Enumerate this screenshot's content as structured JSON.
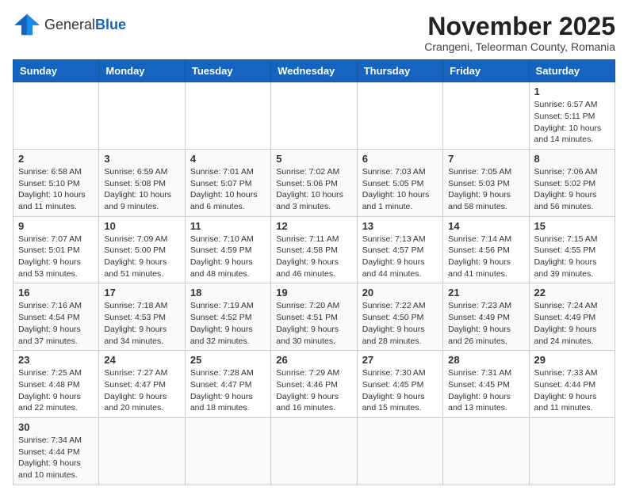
{
  "logo": {
    "text_general": "General",
    "text_blue": "Blue"
  },
  "title": "November 2025",
  "subtitle": "Crangeni, Teleorman County, Romania",
  "days_header": [
    "Sunday",
    "Monday",
    "Tuesday",
    "Wednesday",
    "Thursday",
    "Friday",
    "Saturday"
  ],
  "weeks": [
    [
      {
        "day": "",
        "info": ""
      },
      {
        "day": "",
        "info": ""
      },
      {
        "day": "",
        "info": ""
      },
      {
        "day": "",
        "info": ""
      },
      {
        "day": "",
        "info": ""
      },
      {
        "day": "",
        "info": ""
      },
      {
        "day": "1",
        "info": "Sunrise: 6:57 AM\nSunset: 5:11 PM\nDaylight: 10 hours and 14 minutes."
      }
    ],
    [
      {
        "day": "2",
        "info": "Sunrise: 6:58 AM\nSunset: 5:10 PM\nDaylight: 10 hours and 11 minutes."
      },
      {
        "day": "3",
        "info": "Sunrise: 6:59 AM\nSunset: 5:08 PM\nDaylight: 10 hours and 9 minutes."
      },
      {
        "day": "4",
        "info": "Sunrise: 7:01 AM\nSunset: 5:07 PM\nDaylight: 10 hours and 6 minutes."
      },
      {
        "day": "5",
        "info": "Sunrise: 7:02 AM\nSunset: 5:06 PM\nDaylight: 10 hours and 3 minutes."
      },
      {
        "day": "6",
        "info": "Sunrise: 7:03 AM\nSunset: 5:05 PM\nDaylight: 10 hours and 1 minute."
      },
      {
        "day": "7",
        "info": "Sunrise: 7:05 AM\nSunset: 5:03 PM\nDaylight: 9 hours and 58 minutes."
      },
      {
        "day": "8",
        "info": "Sunrise: 7:06 AM\nSunset: 5:02 PM\nDaylight: 9 hours and 56 minutes."
      }
    ],
    [
      {
        "day": "9",
        "info": "Sunrise: 7:07 AM\nSunset: 5:01 PM\nDaylight: 9 hours and 53 minutes."
      },
      {
        "day": "10",
        "info": "Sunrise: 7:09 AM\nSunset: 5:00 PM\nDaylight: 9 hours and 51 minutes."
      },
      {
        "day": "11",
        "info": "Sunrise: 7:10 AM\nSunset: 4:59 PM\nDaylight: 9 hours and 48 minutes."
      },
      {
        "day": "12",
        "info": "Sunrise: 7:11 AM\nSunset: 4:58 PM\nDaylight: 9 hours and 46 minutes."
      },
      {
        "day": "13",
        "info": "Sunrise: 7:13 AM\nSunset: 4:57 PM\nDaylight: 9 hours and 44 minutes."
      },
      {
        "day": "14",
        "info": "Sunrise: 7:14 AM\nSunset: 4:56 PM\nDaylight: 9 hours and 41 minutes."
      },
      {
        "day": "15",
        "info": "Sunrise: 7:15 AM\nSunset: 4:55 PM\nDaylight: 9 hours and 39 minutes."
      }
    ],
    [
      {
        "day": "16",
        "info": "Sunrise: 7:16 AM\nSunset: 4:54 PM\nDaylight: 9 hours and 37 minutes."
      },
      {
        "day": "17",
        "info": "Sunrise: 7:18 AM\nSunset: 4:53 PM\nDaylight: 9 hours and 34 minutes."
      },
      {
        "day": "18",
        "info": "Sunrise: 7:19 AM\nSunset: 4:52 PM\nDaylight: 9 hours and 32 minutes."
      },
      {
        "day": "19",
        "info": "Sunrise: 7:20 AM\nSunset: 4:51 PM\nDaylight: 9 hours and 30 minutes."
      },
      {
        "day": "20",
        "info": "Sunrise: 7:22 AM\nSunset: 4:50 PM\nDaylight: 9 hours and 28 minutes."
      },
      {
        "day": "21",
        "info": "Sunrise: 7:23 AM\nSunset: 4:49 PM\nDaylight: 9 hours and 26 minutes."
      },
      {
        "day": "22",
        "info": "Sunrise: 7:24 AM\nSunset: 4:49 PM\nDaylight: 9 hours and 24 minutes."
      }
    ],
    [
      {
        "day": "23",
        "info": "Sunrise: 7:25 AM\nSunset: 4:48 PM\nDaylight: 9 hours and 22 minutes."
      },
      {
        "day": "24",
        "info": "Sunrise: 7:27 AM\nSunset: 4:47 PM\nDaylight: 9 hours and 20 minutes."
      },
      {
        "day": "25",
        "info": "Sunrise: 7:28 AM\nSunset: 4:47 PM\nDaylight: 9 hours and 18 minutes."
      },
      {
        "day": "26",
        "info": "Sunrise: 7:29 AM\nSunset: 4:46 PM\nDaylight: 9 hours and 16 minutes."
      },
      {
        "day": "27",
        "info": "Sunrise: 7:30 AM\nSunset: 4:45 PM\nDaylight: 9 hours and 15 minutes."
      },
      {
        "day": "28",
        "info": "Sunrise: 7:31 AM\nSunset: 4:45 PM\nDaylight: 9 hours and 13 minutes."
      },
      {
        "day": "29",
        "info": "Sunrise: 7:33 AM\nSunset: 4:44 PM\nDaylight: 9 hours and 11 minutes."
      }
    ],
    [
      {
        "day": "30",
        "info": "Sunrise: 7:34 AM\nSunset: 4:44 PM\nDaylight: 9 hours and 10 minutes."
      },
      {
        "day": "",
        "info": ""
      },
      {
        "day": "",
        "info": ""
      },
      {
        "day": "",
        "info": ""
      },
      {
        "day": "",
        "info": ""
      },
      {
        "day": "",
        "info": ""
      },
      {
        "day": "",
        "info": ""
      }
    ]
  ]
}
